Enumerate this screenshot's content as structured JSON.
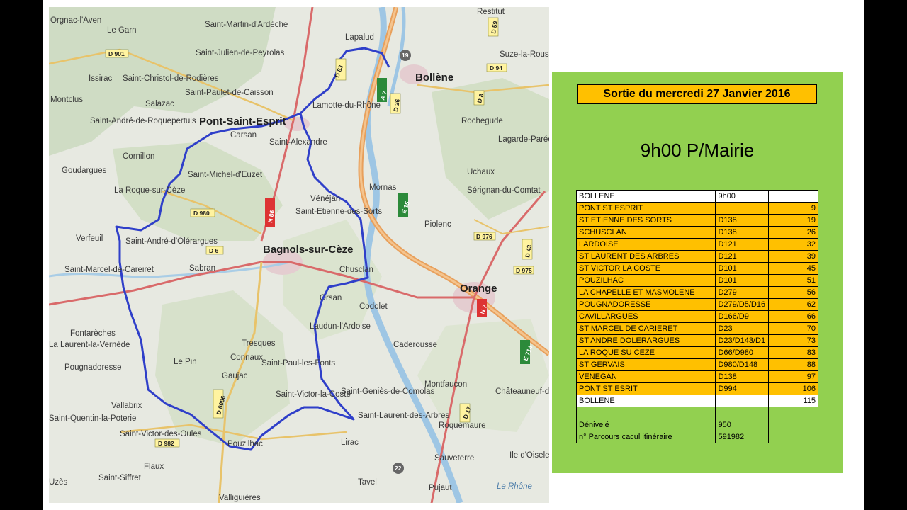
{
  "panel": {
    "title": "Sortie du mercredi 27 Janvier  2016",
    "time": "9h00 P/Mairie"
  },
  "itinerary": [
    {
      "place": "BOLLENE",
      "road": "9h00",
      "km": "",
      "style": "white"
    },
    {
      "place": "PONT ST ESPRIT",
      "road": "",
      "km": "9",
      "style": "orange"
    },
    {
      "place": "ST ETIENNE DES SORTS",
      "road": "D138",
      "km": "19",
      "style": "orange"
    },
    {
      "place": "SCHUSCLAN",
      "road": "D138",
      "km": "26",
      "style": "orange"
    },
    {
      "place": "LARDOISE",
      "road": "D121",
      "km": "32",
      "style": "orange"
    },
    {
      "place": "ST LAURENT DES ARBRES",
      "road": "D121",
      "km": "39",
      "style": "orange"
    },
    {
      "place": "ST VICTOR LA COSTE",
      "road": "D101",
      "km": "45",
      "style": "orange"
    },
    {
      "place": "POUZILHAC",
      "road": "D101",
      "km": "51",
      "style": "orange"
    },
    {
      "place": "LA CHAPELLE  ET MASMOLENE",
      "road": "D279",
      "km": "56",
      "style": "orange"
    },
    {
      "place": "POUGNADORESSE",
      "road": "D279/D5/D16",
      "km": "62",
      "style": "orange"
    },
    {
      "place": "CAVILLARGUES",
      "road": "D166/D9",
      "km": "66",
      "style": "orange"
    },
    {
      "place": "ST MARCEL DE CARIERET",
      "road": "D23",
      "km": "70",
      "style": "orange"
    },
    {
      "place": "ST ANDRE DOLERARGUES",
      "road": "D23/D143/D1",
      "km": "73",
      "style": "orange"
    },
    {
      "place": "LA ROQUE SU CEZE",
      "road": "D66/D980",
      "km": "83",
      "style": "orange"
    },
    {
      "place": "ST GERVAIS",
      "road": "D980/D148",
      "km": "88",
      "style": "orange"
    },
    {
      "place": "VENEGAN",
      "road": "D138",
      "km": "97",
      "style": "orange"
    },
    {
      "place": "PONT ST ESRIT",
      "road": "D994",
      "km": "106",
      "style": "orange"
    },
    {
      "place": "BOLLENE",
      "road": "",
      "km": "115",
      "style": "white"
    },
    {
      "place": "",
      "road": "",
      "km": "",
      "style": "green"
    },
    {
      "place": "Dénivelé",
      "road": "950",
      "km": "",
      "style": "green"
    },
    {
      "place": "n° Parcours cacul itinéraire",
      "road": "591982",
      "km": "",
      "style": "green"
    }
  ],
  "map": {
    "cities": [
      "Pont-Saint-Esprit",
      "Bollène",
      "Bagnols-sur-Cèze",
      "Orange"
    ],
    "places": [
      "Orgnac-l'Aven",
      "Le Garn",
      "Saint-Martin-d'Ardèche",
      "Lapalud",
      "Suze-la-Rousse",
      "Saint-Julien-de-Peyrolas",
      "Issirac",
      "Saint-Christol-de-Rodières",
      "Saint-Paulet-de-Caisson",
      "Lamotte-du-Rhône",
      "Montclus",
      "Salazac",
      "Carsan",
      "Rochegude",
      "Saint-André-de-Roquepertuis",
      "Saint-Alexandre",
      "Lagarde-Paréol",
      "Cornillon",
      "Goudargues",
      "Saint-Michel-d'Euzet",
      "Uchaux",
      "Mornas",
      "La Roque-sur-Cèze",
      "Vénéjan",
      "Saint-Etienne-des-Sorts",
      "Sérignan-du-Comtat",
      "Piolenc",
      "Verfeuil",
      "Saint-André-d'Olérargues",
      "Sabran",
      "Saint-Marcel-de-Careiret",
      "Chusclan",
      "Orsan",
      "Codolet",
      "Fontarèches",
      "Laudun-l'Ardoise",
      "La Laurent-la-Vernède",
      "Tresques",
      "Caderousse",
      "Connaux",
      "Le Pin",
      "Pougnadoresse",
      "Gaujac",
      "Saint-Paul-les-Fonts",
      "Saint-Victor-la-Coste",
      "Saint-Geniès-de-Comolas",
      "Montfaucon",
      "Châteauneuf-du-Pape",
      "Vallabrix",
      "Saint-Quentin-la-Poterie",
      "Saint-Laurent-des-Arbres",
      "Roquemaure",
      "Saint-Victor-des-Oules",
      "Pouzilhac",
      "Lirac",
      "Ile d'Oiselet",
      "Flaux",
      "Sauveterre",
      "Uzès",
      "Saint-Siffret",
      "Tavel",
      "Pujaut",
      "Valliguières",
      "Restitut",
      "Le Rhône"
    ],
    "road_labels": [
      "D 901",
      "D 6086",
      "D 83",
      "D 59",
      "D 94",
      "D 8",
      "D 26",
      "A 7",
      "N 86",
      "D 980",
      "D 6",
      "E 15",
      "D 976",
      "D 43",
      "D 975",
      "N 7",
      "E 714",
      "D 6086",
      "D 17",
      "D 982",
      "22",
      "19"
    ]
  }
}
